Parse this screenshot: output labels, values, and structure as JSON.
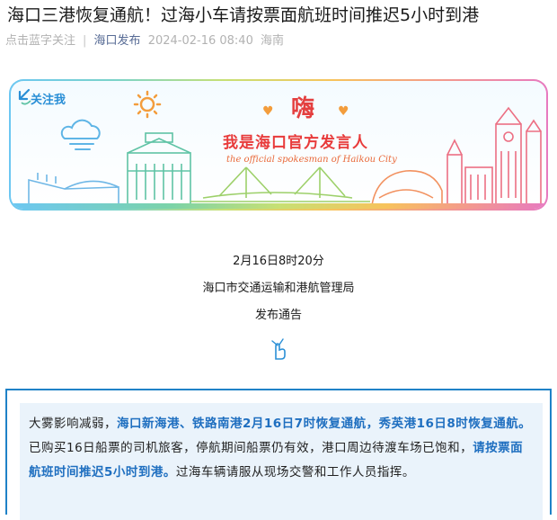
{
  "article": {
    "title": "海口三港恢复通航！过海小车请按票面航班时间推迟5小时到港",
    "meta": {
      "follow_hint": "点击蓝字关注",
      "account": "海口发布",
      "datetime": "2024-02-16 08:40",
      "location": "海南"
    }
  },
  "banner": {
    "follow_label": "关注我",
    "hi": "嗨",
    "slogan": "我是海口官方发言人",
    "slogan_en": "the official spokesman of Haikou City"
  },
  "announcement": {
    "time": "2月16日8时20分",
    "issuer": "海口市交通运输和港航管理局",
    "type": "发布通告"
  },
  "notice": {
    "p1": "大雾影响减弱，",
    "h1": "海口新海港、铁路南港2月16日7时恢复通航，秀英港16日8时恢复通航。",
    "p2": "已购买16日船票的司机旅客，停航期间船票仍有效，港口周边待渡车场已饱和，",
    "h2": "请按票面航班时间推迟5小时到港。",
    "p3": "过海车辆请服从现场交警和工作人员指挥。"
  },
  "colors": {
    "link": "#576b95",
    "highlight": "#1f6fc0",
    "notice_border": "#1f82c7",
    "notice_bg": "#eaf3fb",
    "slogan": "#e83b3b"
  },
  "icons": [
    "follow-arrow-icon",
    "sun-icon",
    "cloud-icon",
    "heart-icon",
    "pointing-hand-icon"
  ]
}
